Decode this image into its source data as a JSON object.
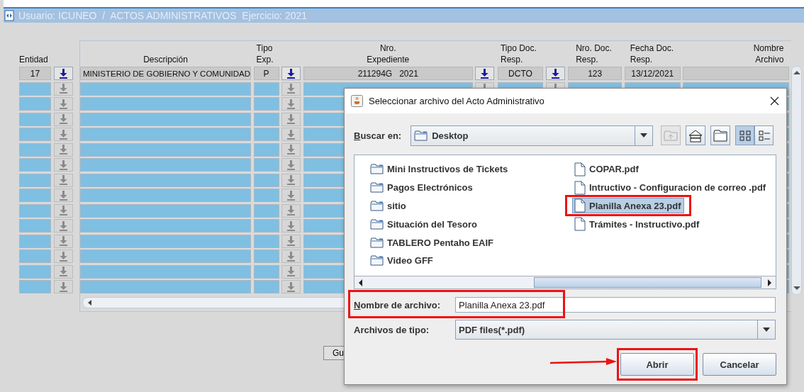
{
  "window": {
    "title": "Usuario: ICUNEO  /  ACTOS ADMINISTRATIVOS  Ejercicio: 2021"
  },
  "form": {
    "entidad_label": "Entidad",
    "columns": [
      {
        "label": "Descripción"
      },
      {
        "label": "Tipo\nExp."
      },
      {
        "label": "Nro.\nExpediente"
      },
      {
        "label": "Tipo Doc.\nResp."
      },
      {
        "label": "Nro. Doc.\nResp."
      },
      {
        "label": "Fecha Doc.\nResp."
      },
      {
        "label": "Nombre\nArchivo"
      }
    ],
    "rows": [
      {
        "entidad": "17",
        "descripcion": "MINISTERIO DE GOBIERNO Y COMUNIDAD",
        "tipo_exp": "P",
        "nro_expediente": "211294G   2021",
        "tipo_doc_resp": "DCTO",
        "nro_doc_resp": "123",
        "fecha_doc_resp": "13/12/2021",
        "disabled": false
      },
      {
        "disabled": true
      },
      {
        "disabled": true
      },
      {
        "disabled": true
      },
      {
        "disabled": true
      },
      {
        "disabled": true
      },
      {
        "disabled": true
      },
      {
        "disabled": true
      },
      {
        "disabled": true
      },
      {
        "disabled": true
      },
      {
        "disabled": true
      },
      {
        "disabled": true
      },
      {
        "disabled": true
      },
      {
        "disabled": true
      },
      {
        "disabled": true
      }
    ],
    "button": "Gu"
  },
  "dialog": {
    "title": "Seleccionar archivo del Acto Administrativo",
    "look_in_label": "Buscar en:",
    "look_in_value": "Desktop",
    "view_buttons": [
      {
        "selected": true
      },
      {
        "selected": false
      }
    ],
    "files": [
      {
        "kind": "folder",
        "name": "Mini Instructivos de Tickets",
        "selected": false,
        "highlighted": false
      },
      {
        "kind": "folder",
        "name": "Pagos Electrónicos",
        "selected": false,
        "highlighted": false
      },
      {
        "kind": "folder",
        "name": "sitio",
        "selected": false,
        "highlighted": false
      },
      {
        "kind": "folder",
        "name": "Situación del Tesoro",
        "selected": false,
        "highlighted": false
      },
      {
        "kind": "folder",
        "name": "TABLERO Pentaho EAIF",
        "selected": false,
        "highlighted": false
      },
      {
        "kind": "folder",
        "name": "Video GFF",
        "selected": false,
        "highlighted": false
      },
      {
        "kind": "file",
        "name": "COPAR.pdf",
        "selected": false,
        "highlighted": false
      },
      {
        "kind": "file",
        "name": "Intructivo - Configuracion de correo .pdf",
        "selected": false,
        "highlighted": false
      },
      {
        "kind": "file",
        "name": "Planilla Anexa 23.pdf",
        "selected": true,
        "highlighted": true
      },
      {
        "kind": "file",
        "name": "Trámites - Instructivo.pdf",
        "selected": false,
        "highlighted": false
      }
    ],
    "file_name_label": "Nombre de archivo:",
    "file_name": "Planilla Anexa 23.pdf",
    "file_name_highlighted": true,
    "file_type_label": "Archivos de tipo:",
    "file_type": "PDF files(*.pdf)",
    "buttons": [
      {
        "label": "Abrir",
        "highlighted": true
      },
      {
        "label": "Cancelar",
        "highlighted": false
      }
    ]
  }
}
